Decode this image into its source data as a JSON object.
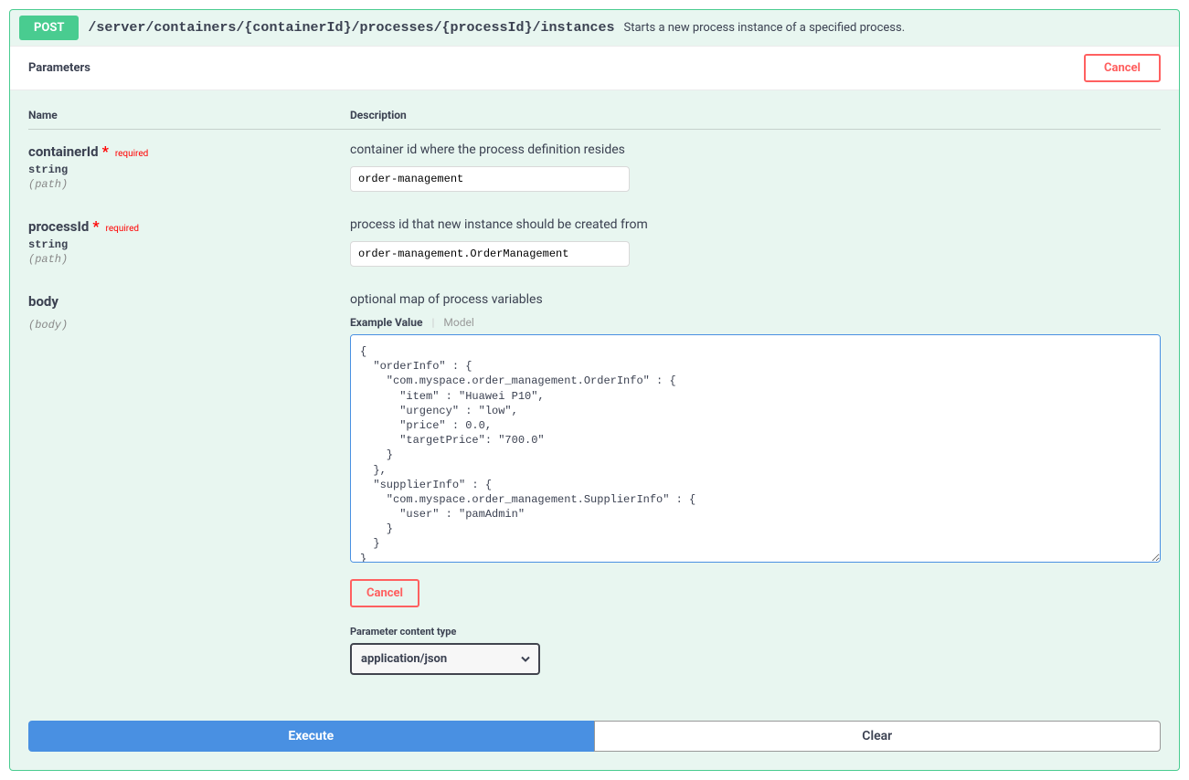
{
  "endpoint": {
    "method": "POST",
    "path": "/server/containers/{containerId}/processes/{processId}/instances",
    "summary": "Starts a new process instance of a specified process."
  },
  "parametersBar": {
    "title": "Parameters",
    "cancel": "Cancel"
  },
  "columns": {
    "name": "Name",
    "description": "Description"
  },
  "params": [
    {
      "name": "containerId",
      "required": true,
      "requiredLabel": "required",
      "type": "string",
      "in": "(path)",
      "description": "container id where the process definition resides",
      "value": "order-management",
      "inputKind": "text"
    },
    {
      "name": "processId",
      "required": true,
      "requiredLabel": "required",
      "type": "string",
      "in": "(path)",
      "description": "process id that new instance should be created from",
      "value": "order-management.OrderManagement",
      "inputKind": "text"
    },
    {
      "name": "body",
      "required": false,
      "type": "",
      "in": "(body)",
      "description": "optional map of process variables",
      "inputKind": "body"
    }
  ],
  "bodyTabs": {
    "active": "Example Value",
    "inactive": "Model"
  },
  "bodyValue": "{\n  \"orderInfo\" : {\n    \"com.myspace.order_management.OrderInfo\" : {\n      \"item\" : \"Huawei P10\",\n      \"urgency\" : \"low\",\n      \"price\" : 0.0,\n      \"targetPrice\": \"700.0\"\n    }\n  },\n  \"supplierInfo\" : {\n    \"com.myspace.order_management.SupplierInfo\" : {\n      \"user\" : \"pamAdmin\"\n    }\n  }\n}",
  "bodyCancel": "Cancel",
  "contentType": {
    "label": "Parameter content type",
    "value": "application/json"
  },
  "actions": {
    "execute": "Execute",
    "clear": "Clear"
  }
}
